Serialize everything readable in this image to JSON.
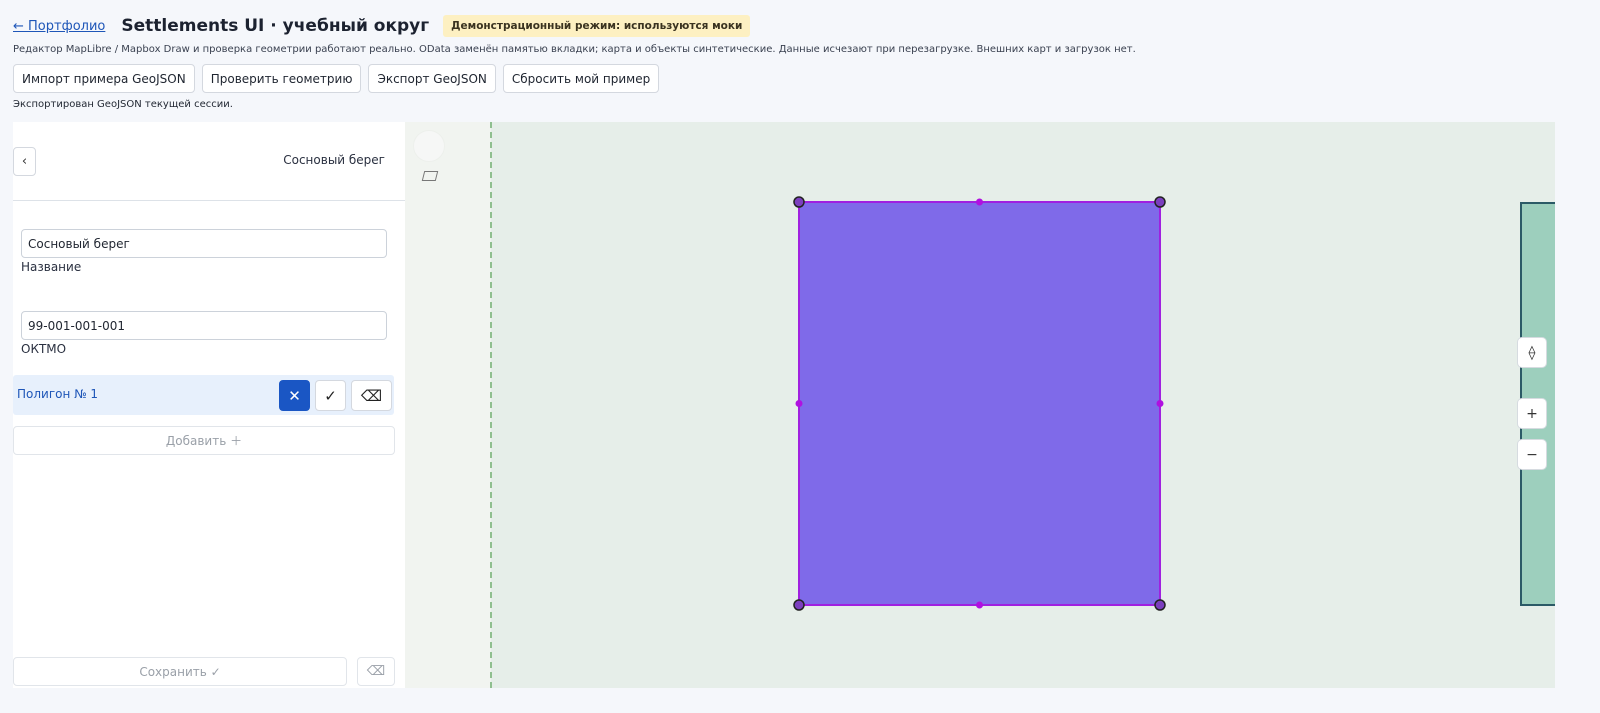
{
  "header": {
    "back_link": "← Портфолио",
    "title": "Settlements UI · учебный округ",
    "badge": "Демонстрационный режим: используются моки"
  },
  "description": "Редактор MapLibre / Mapbox Draw и проверка геометрии работают реально. OData заменён памятью вкладки; карта и объекты синтетические. Данные исчезают при перезагрузке. Внешних карт и загрузок нет.",
  "toolbar": {
    "import_label": "Импорт примера GeoJSON",
    "check_label": "Проверить геометрию",
    "export_label": "Экспорт GeoJSON",
    "reset_label": "Сбросить мой пример"
  },
  "status": "Экспортирован GeoJSON текущей сессии.",
  "sidebar": {
    "back_icon": "‹",
    "title": "Сосновый берег",
    "name_value": "Сосновый берег",
    "name_label": "Название",
    "oktmo_value": "99-001-001-001",
    "oktmo_label": "ОКТМО",
    "polygon_label": "Полигон № 1",
    "polygon_close_icon": "✕",
    "polygon_confirm_icon": "✓",
    "polygon_delete_icon": "⌫",
    "add_label": "Добавить ＋",
    "save_label": "Сохранить ✓",
    "save_delete_icon": "⌫"
  },
  "map": {
    "controls": {
      "compass": "⟠",
      "zoom_in": "+",
      "zoom_out": "−"
    },
    "colors": {
      "polygon_fill": "#7f6ae9",
      "polygon_stroke": "#a020e0",
      "vertex_fill": "#7c3fbf",
      "vertex_stroke": "#222222",
      "midpoint": "#b010e0"
    }
  }
}
